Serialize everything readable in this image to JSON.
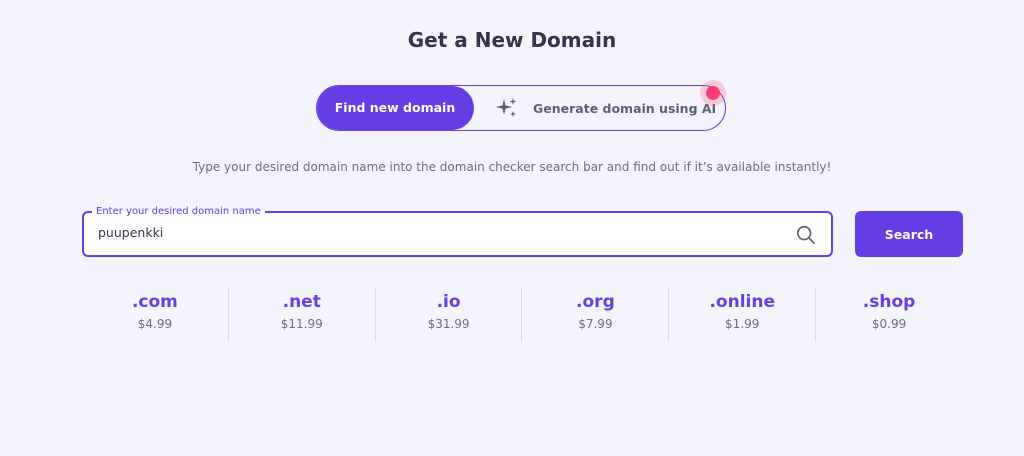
{
  "header": {
    "title": "Get a New Domain"
  },
  "mode_toggle": {
    "find_label": "Find new domain",
    "ai_label": "Generate domain using AI",
    "ai_icon": "sparkles-icon",
    "notification_dot": true
  },
  "subtitle": "Type your desired domain name into the domain checker search bar and find out if it’s available instantly!",
  "search": {
    "label": "Enter your desired domain name",
    "value": "puupenkki",
    "button_label": "Search",
    "icon": "search-icon"
  },
  "tlds": [
    {
      "name": ".com",
      "price": "$4.99"
    },
    {
      "name": ".net",
      "price": "$11.99"
    },
    {
      "name": ".io",
      "price": "$31.99"
    },
    {
      "name": ".org",
      "price": "$7.99"
    },
    {
      "name": ".online",
      "price": "$1.99"
    },
    {
      "name": ".shop",
      "price": "$0.99"
    }
  ],
  "colors": {
    "accent": "#673de6",
    "background": "#f4f4fc",
    "notification": "#fc3c72"
  }
}
